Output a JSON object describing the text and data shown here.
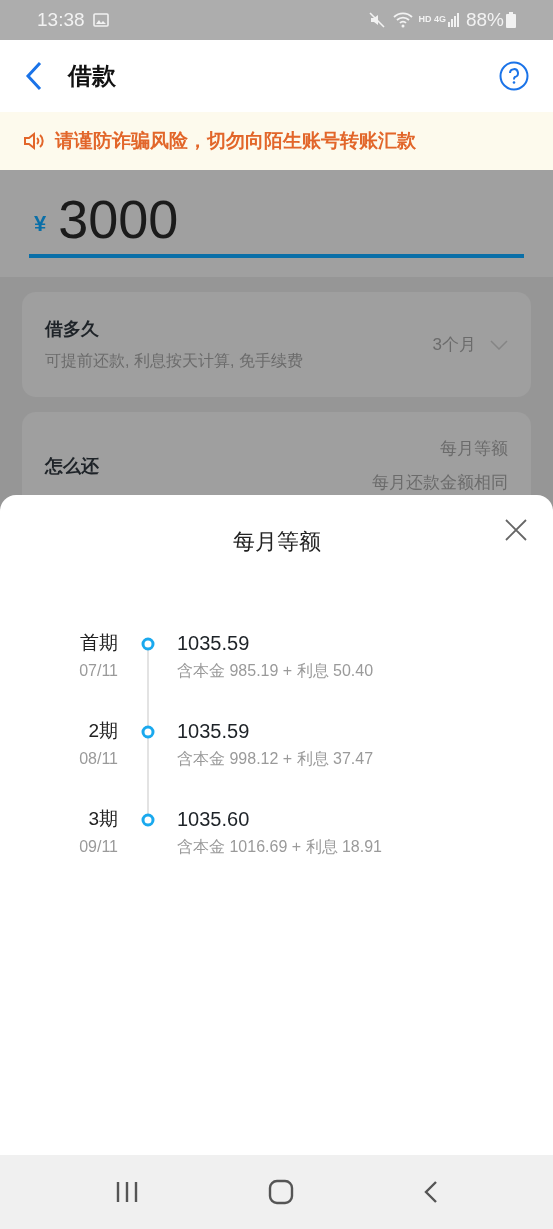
{
  "status_bar": {
    "time": "13:38",
    "battery": "88%",
    "network": "HD 4G"
  },
  "header": {
    "title": "借款"
  },
  "notice": {
    "text": "请谨防诈骗风险，切勿向陌生账号转账汇款"
  },
  "amount": {
    "currency": "¥",
    "value": "3000"
  },
  "term": {
    "label": "借多久",
    "hint": "可提前还款, 利息按天计算, 免手续费",
    "value": "3个月"
  },
  "repay": {
    "label": "怎么还",
    "value": "每月等额",
    "hint": "每月还款金额相同"
  },
  "sheet": {
    "title": "每月等额",
    "schedule": [
      {
        "period": "首期",
        "date": "07/11",
        "amount": "1035.59",
        "detail": "含本金 985.19 + 利息 50.40"
      },
      {
        "period": "2期",
        "date": "08/11",
        "amount": "1035.59",
        "detail": "含本金 998.12 + 利息 37.47"
      },
      {
        "period": "3期",
        "date": "09/11",
        "amount": "1035.60",
        "detail": "含本金 1016.69 + 利息 18.91"
      }
    ]
  }
}
